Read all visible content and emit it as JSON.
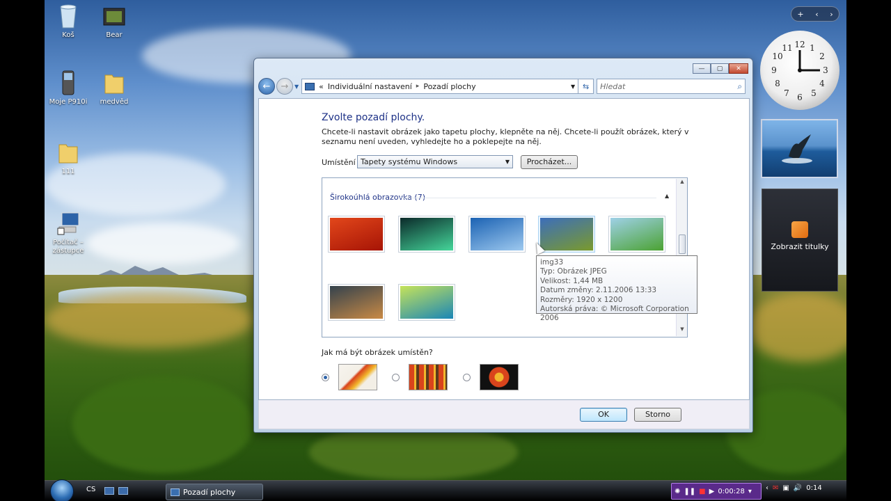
{
  "desktop": {
    "icons": [
      {
        "label": "Koš",
        "icon": "recycle-bin-icon"
      },
      {
        "label": "Bear",
        "icon": "video-icon"
      },
      {
        "label": "Moje P910i",
        "icon": "phone-icon"
      },
      {
        "label": "medvěd",
        "icon": "folder-icon"
      },
      {
        "label": "111",
        "icon": "folder-icon"
      },
      {
        "label": "Počítač – zástupce",
        "icon": "computer-shortcut-icon"
      }
    ]
  },
  "sidebar": {
    "controls": "+",
    "feed_label": "Zobrazit titulky"
  },
  "window": {
    "breadcrumb": [
      "Individuální nastavení",
      "Pozadí plochy"
    ],
    "breadcrumb_prefix": "«",
    "search_placeholder": "Hledat",
    "heading": "Zvolte pozadí plochy.",
    "description": "Chcete-li nastavit obrázek jako tapetu plochy, klepněte na něj. Chcete-li použít obrázek, který v seznamu není uveden, vyhledejte ho a poklepejte na něj.",
    "location_label": "Umístění",
    "location_value": "Tapety systému Windows",
    "browse_label": "Procházet...",
    "group_header": "Širokoúhlá obrazovka (7)",
    "thumbnails": [
      {
        "name": "red-flower",
        "colors": [
          "#e2471b",
          "#a61405"
        ]
      },
      {
        "name": "aurora",
        "colors": [
          "#0b2a2a",
          "#45d69a"
        ]
      },
      {
        "name": "fish",
        "colors": [
          "#1b62b3",
          "#9ec9ef"
        ]
      },
      {
        "name": "green-hills",
        "colors": [
          "#3c6ebb",
          "#7a9a2c"
        ]
      },
      {
        "name": "palm-leaf",
        "colors": [
          "#9fd1e8",
          "#4ba232"
        ]
      },
      {
        "name": "rock-lake",
        "colors": [
          "#34424d",
          "#c98a45"
        ]
      },
      {
        "name": "aurora-green",
        "colors": [
          "#c6e35a",
          "#1a86b6"
        ]
      }
    ],
    "tooltip": {
      "name": "img33",
      "type": "Typ: Obrázek JPEG",
      "size": "Velikost: 1,44 MB",
      "date": "Datum změny: 2.11.2006 13:33",
      "dims": "Rozměry: 1920 x 1200",
      "copyright": "Autorská práva: © Microsoft Corporation 2006"
    },
    "position_label": "Jak má být obrázek umístěn?",
    "position_selected": 0,
    "ok_label": "OK",
    "cancel_label": "Storno"
  },
  "taskbar": {
    "lang": "CS",
    "task_label": "Pozadí plochy",
    "media_time": "0:00:28",
    "clock": "0:14"
  },
  "colors": {
    "heading": "#1e3287",
    "accent": "#2d63a8"
  }
}
